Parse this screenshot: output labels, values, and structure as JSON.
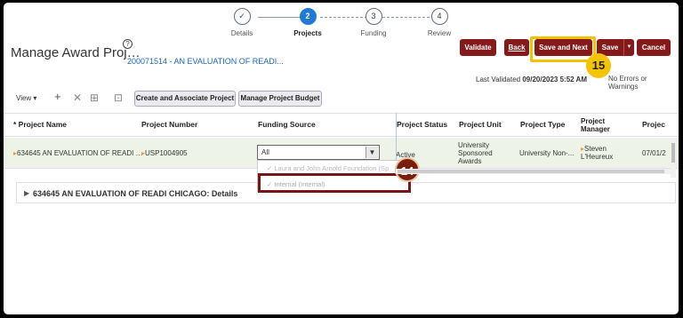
{
  "train": {
    "steps": [
      {
        "num": "✓",
        "label": "Details",
        "state": "done"
      },
      {
        "num": "2",
        "label": "Projects",
        "state": "active"
      },
      {
        "num": "3",
        "label": "Funding",
        "state": "todo"
      },
      {
        "num": "4",
        "label": "Review",
        "state": "todo"
      }
    ]
  },
  "header": {
    "title": "Manage Award Proj…",
    "help": "?",
    "award_link": "200071514 - AN EVALUATION OF READI..."
  },
  "actions": {
    "validate": "Validate",
    "back": "Back",
    "save_next": "Save and Next",
    "save": "Save",
    "save_caret": "▼",
    "cancel": "Cancel"
  },
  "status": {
    "validated_label": "Last Validated",
    "validated_value": "09/20/2023 5:52 AM",
    "no_errors": "No Errors or Warnings"
  },
  "toolbar": {
    "view": "View ▾",
    "add": "+",
    "delete": "✕",
    "freeze": "⊞",
    "detach": "⊡",
    "create_assoc": "Create and Associate Project",
    "manage_budget": "Manage Project Budget"
  },
  "table": {
    "columns": {
      "name": "* Project Name",
      "number": "Project Number",
      "funding": "Funding Source",
      "status": "Project Status",
      "unit": "Project Unit",
      "type": "Project Type",
      "manager_l1": "Project",
      "manager_l2": "Manager",
      "proj": "Projec"
    },
    "row": {
      "name": "634645 AN EVALUATION OF READI …",
      "number": "USP1004905",
      "funding": "All",
      "status": "Active",
      "unit_l1": "University",
      "unit_l2": "Sponsored",
      "unit_l3": "Awards",
      "type": "University Non-...",
      "manager_l1": "Steven",
      "manager_l2": "L'Heureux",
      "date": "07/01/2"
    },
    "dropdown": {
      "option1": "Laura and John Arnold Foundation (Sp",
      "option2": "Internal (Internal)"
    }
  },
  "details": {
    "label": "634645 AN EVALUATION OF READI CHICAGO: Details"
  },
  "callouts": {
    "b15": "15",
    "b14": "14"
  }
}
